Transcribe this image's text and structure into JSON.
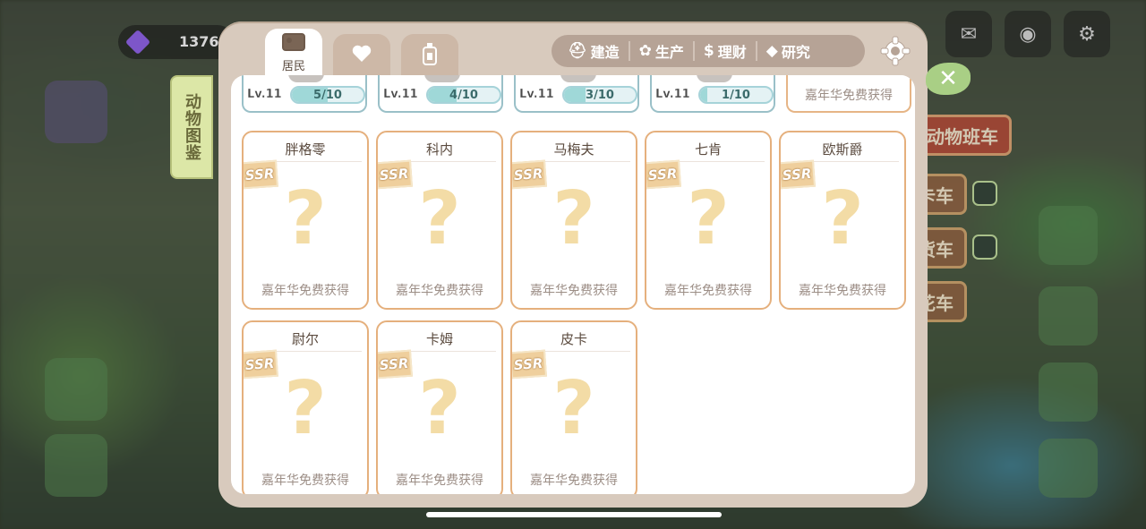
{
  "background": {
    "gem_count": "1376",
    "side_labels": [
      "动物班车",
      "卡车",
      "货车",
      "花车"
    ]
  },
  "tabs": [
    {
      "name": "residents",
      "label": "居民",
      "icon": "id-card-icon",
      "active": true
    },
    {
      "name": "favorites",
      "label": "",
      "icon": "heart-icon",
      "active": false
    },
    {
      "name": "items",
      "label": "",
      "icon": "bottle-icon",
      "active": false
    }
  ],
  "categories": [
    {
      "icon": "helmet-icon",
      "label": "建造"
    },
    {
      "icon": "bee-icon",
      "label": "生产"
    },
    {
      "icon": "dollar-icon",
      "label": "理财"
    },
    {
      "icon": "graduation-cap-icon",
      "label": "研究"
    }
  ],
  "side_tab": {
    "label": "动物图鉴"
  },
  "top_row": [
    {
      "level": "Lv.11",
      "progress": "5/10",
      "fraction": 0.5
    },
    {
      "level": "Lv.11",
      "progress": "4/10",
      "fraction": 0.4
    },
    {
      "level": "Lv.11",
      "progress": "3/10",
      "fraction": 0.3
    },
    {
      "level": "Lv.11",
      "progress": "1/10",
      "fraction": 0.1
    },
    {
      "free_text": "嘉年华免费获得"
    }
  ],
  "cards": [
    {
      "name": "胖格零",
      "rarity": "SSR",
      "mark": "?",
      "source": "嘉年华免费获得"
    },
    {
      "name": "科内",
      "rarity": "SSR",
      "mark": "?",
      "source": "嘉年华免费获得"
    },
    {
      "name": "马梅夫",
      "rarity": "SSR",
      "mark": "?",
      "source": "嘉年华免费获得"
    },
    {
      "name": "七肯",
      "rarity": "SSR",
      "mark": "?",
      "source": "嘉年华免费获得"
    },
    {
      "name": "欧斯爵",
      "rarity": "SSR",
      "mark": "?",
      "source": "嘉年华免费获得"
    },
    {
      "name": "尉尔",
      "rarity": "SSR",
      "mark": "?",
      "source": "嘉年华免费获得"
    },
    {
      "name": "卡姆",
      "rarity": "SSR",
      "mark": "?",
      "source": "嘉年华免费获得"
    },
    {
      "name": "皮卡",
      "rarity": "SSR",
      "mark": "?",
      "source": "嘉年华免费获得"
    }
  ]
}
